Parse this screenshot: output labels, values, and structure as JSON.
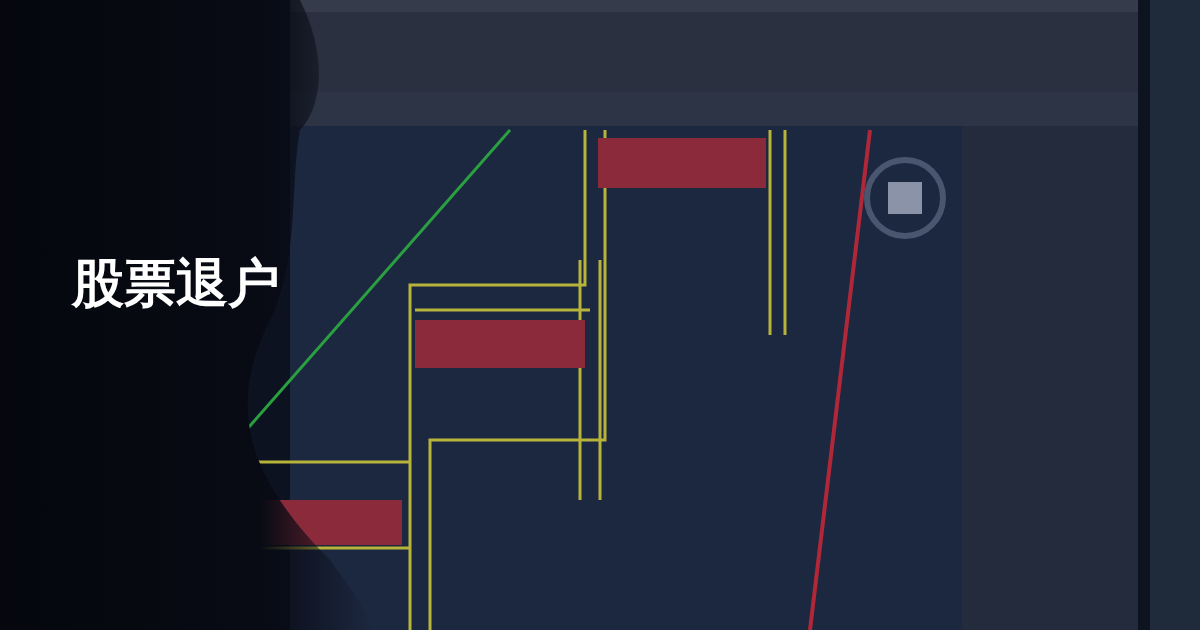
{
  "title": "股票退户"
}
